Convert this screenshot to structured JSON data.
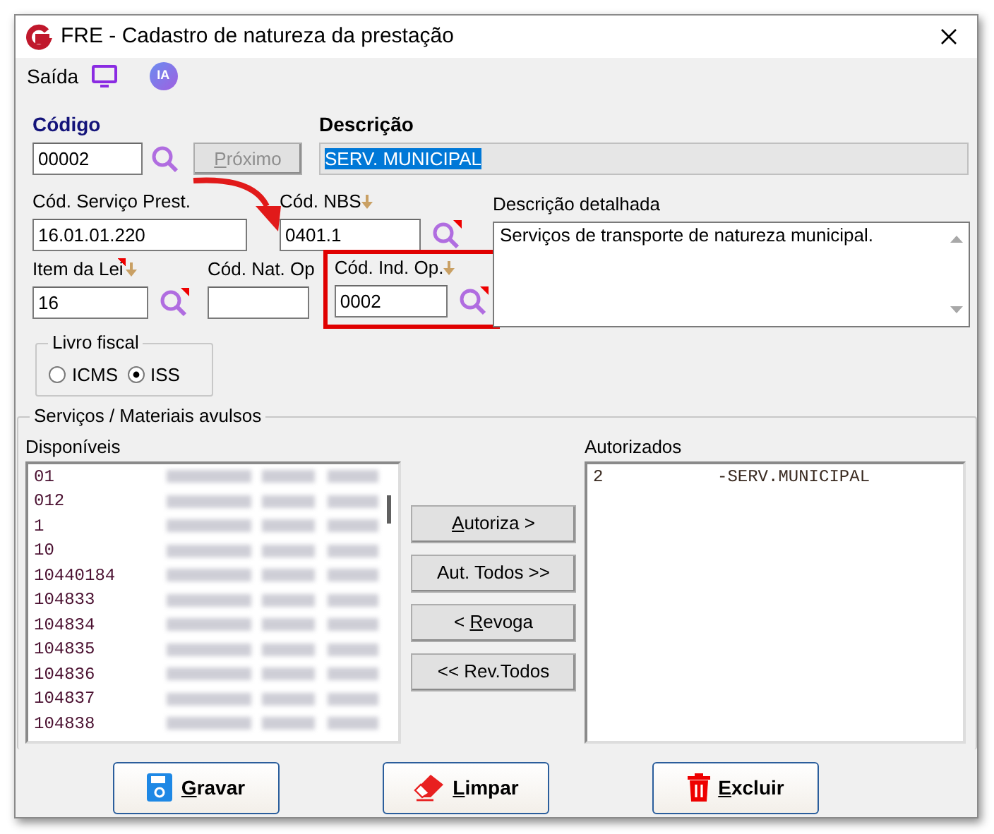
{
  "window": {
    "title": "FRE - Cadastro de natureza da prestação"
  },
  "menu": {
    "label": "Saída",
    "ia_badge": "IA"
  },
  "codigo": {
    "label": "Código",
    "value": "00002",
    "next_button": {
      "mnemonic": "P",
      "label_after": "róximo",
      "disabled": true
    }
  },
  "descricao": {
    "label": "Descrição",
    "value": "SERV. MUNICIPAL",
    "selected": true
  },
  "fields_row_1": [
    {
      "label": "Cód. Serviço Prest.",
      "value": "16.01.01.220",
      "lookup": false,
      "sort_marker": false,
      "flag": false,
      "highlighted": false
    },
    {
      "label": "Cód. NBS",
      "value": "0401.1",
      "lookup": true,
      "sort_marker": true,
      "flag": false,
      "highlighted": false
    }
  ],
  "fields_row_2": [
    {
      "label": "Item da Lei",
      "value": "16",
      "lookup": true,
      "sort_marker": true,
      "flag": true,
      "highlighted": false
    },
    {
      "label": "Cód. Nat. Op",
      "lookup": false,
      "sort_marker": false,
      "flag": false,
      "highlighted": false
    },
    {
      "label": "Cód. Ind. Op.",
      "value": "0002",
      "lookup": true,
      "sort_marker": true,
      "flag": false,
      "highlighted": true
    }
  ],
  "descricao_detalhada": {
    "label": "Descrição detalhada",
    "value": "Serviços de transporte de natureza municipal."
  },
  "livro_fiscal": {
    "label": "Livro fiscal",
    "options": [
      {
        "label": "ICMS",
        "selected": false
      },
      {
        "label": "ISS",
        "selected": true
      }
    ]
  },
  "servicos": {
    "title": "Serviços  /  Materiais avulsos",
    "available": {
      "label": "Disponíveis",
      "rows": [
        {
          "code": "01",
          "blurred": true
        },
        {
          "code": "012",
          "blurred": true
        },
        {
          "code": "1",
          "blurred": true
        },
        {
          "code": "10",
          "blurred": true
        },
        {
          "code": "10440184",
          "blurred": true
        },
        {
          "code": "104833",
          "blurred": true
        },
        {
          "code": "104834",
          "blurred": true
        },
        {
          "code": "104835",
          "blurred": true
        },
        {
          "code": "104836",
          "blurred": true
        },
        {
          "code": "104837",
          "blurred": true
        },
        {
          "code": "104838",
          "blurred": true
        }
      ]
    },
    "buttons": [
      {
        "mnemonic": "A",
        "label_after": "utoriza >"
      },
      {
        "label_after": "Aut. Todos >>"
      },
      {
        "label_before": "< ",
        "mnemonic": "R",
        "label_after": "evoga"
      },
      {
        "label_after": "<< Rev.Todos"
      }
    ],
    "authorized": {
      "label": "Autorizados",
      "rows": [
        {
          "code": "2",
          "description": "-SERV.MUNICIPAL"
        }
      ]
    }
  },
  "actions": [
    {
      "kind": "save",
      "mnemonic": "G",
      "label_after": "ravar"
    },
    {
      "kind": "clear",
      "mnemonic": "L",
      "label_after": "impar"
    },
    {
      "kind": "delete",
      "mnemonic": "E",
      "label_after": "xcluir"
    }
  ]
}
